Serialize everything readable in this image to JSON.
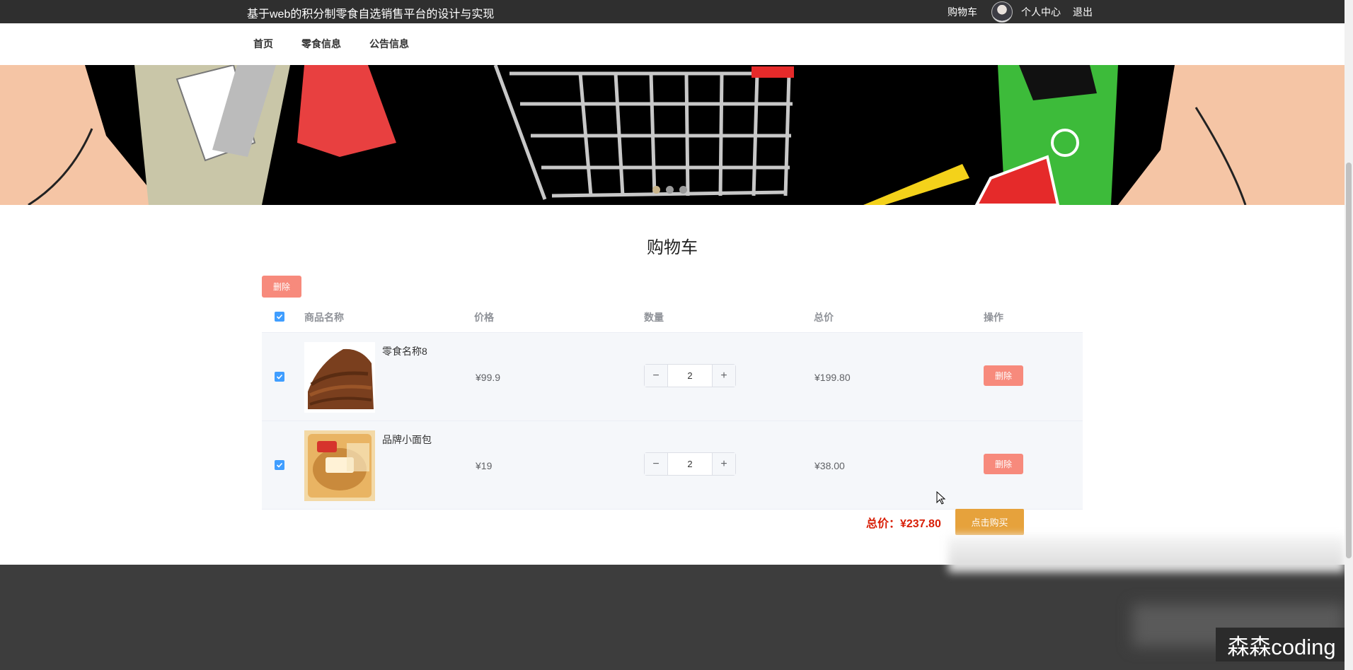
{
  "header": {
    "site_title": "基于web的积分制零食自选销售平台的设计与实现",
    "links": {
      "cart": "购物车",
      "profile": "个人中心",
      "logout": "退出"
    }
  },
  "nav": {
    "items": [
      "首页",
      "零食信息",
      "公告信息"
    ]
  },
  "banner": {
    "slides": 3,
    "active_slide": 0
  },
  "cart": {
    "title": "购物车",
    "delete_selected_label": "删除",
    "columns": [
      "商品名称",
      "价格",
      "数量",
      "总价",
      "操作"
    ],
    "items": [
      {
        "name": "零食名称8",
        "price": "¥99.9",
        "quantity": "2",
        "total": "¥199.80",
        "delete_label": "删除",
        "checked": true
      },
      {
        "name": "品牌小面包",
        "price": "¥19",
        "quantity": "2",
        "total": "¥38.00",
        "delete_label": "删除",
        "checked": true
      }
    ],
    "grand_total": "总价：¥237.80",
    "buy_label": "点击购买",
    "stepper": {
      "minus": "−",
      "plus": "+"
    }
  },
  "watermark": "森森coding",
  "colors": {
    "topbar": "#2f2f2f",
    "accent_red": "#f78a7c",
    "checkbox": "#409eff",
    "buy": "#e6a23c",
    "total_red": "#d81e06",
    "footer": "#3d3d3d"
  }
}
